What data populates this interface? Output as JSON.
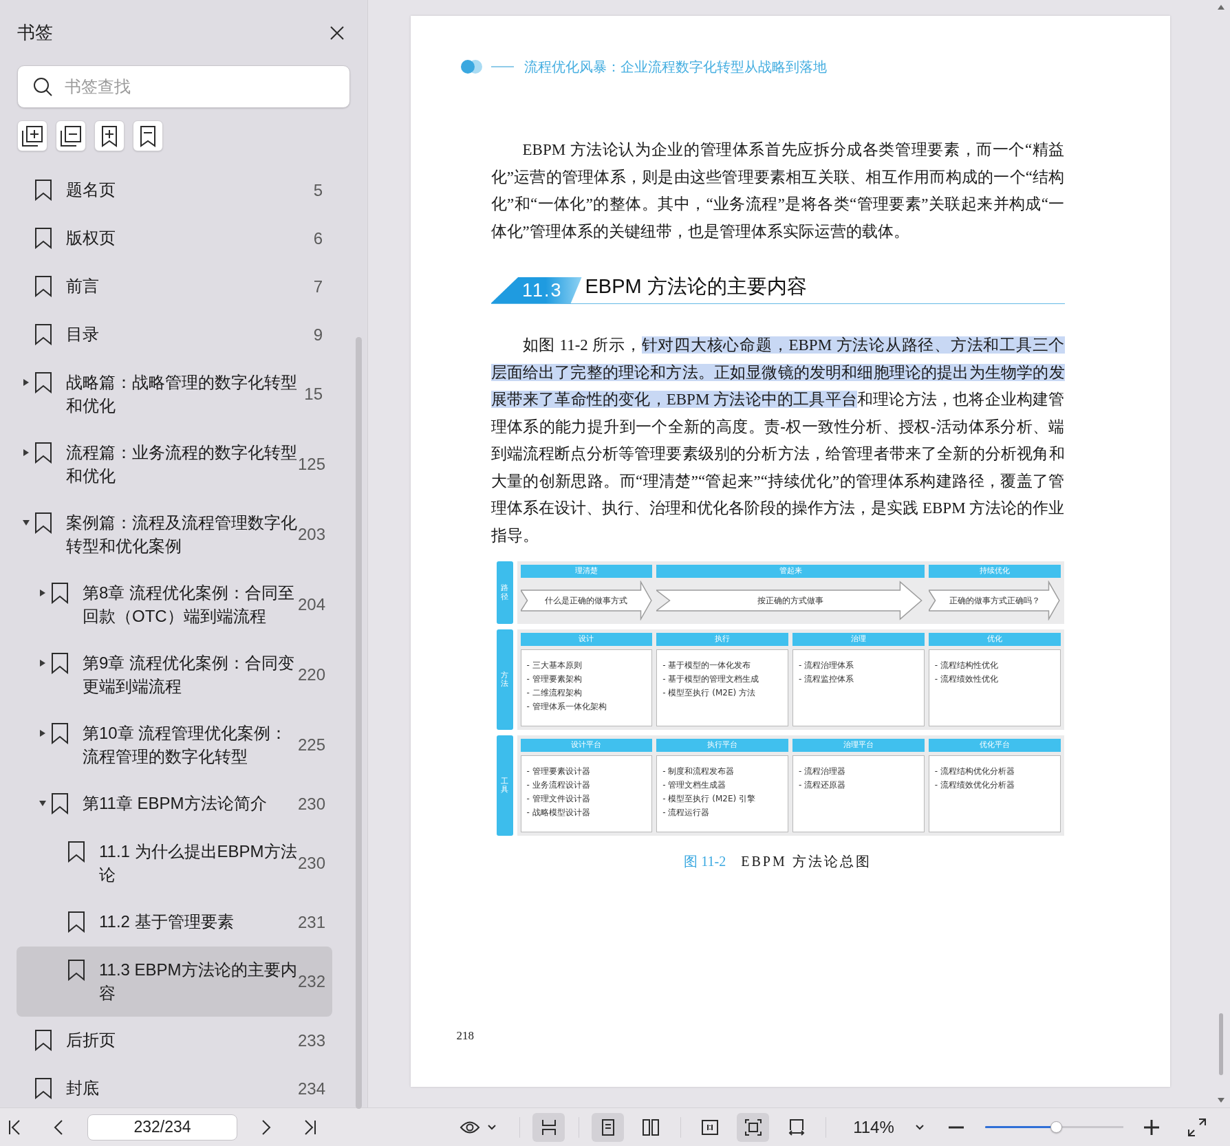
{
  "sidebar": {
    "title": "书签",
    "search": {
      "placeholder": "书签查找"
    },
    "tools": [
      {
        "kind": "expand-all"
      },
      {
        "kind": "collapse-all"
      },
      {
        "kind": "add"
      },
      {
        "kind": "remove"
      }
    ],
    "bookmarks": [
      {
        "label": "题名页",
        "page": "5",
        "selected": false
      },
      {
        "label": "版权页",
        "page": "6",
        "selected": false
      },
      {
        "label": "前言",
        "page": "7",
        "selected": false
      },
      {
        "label": "目录",
        "page": "9",
        "selected": false
      },
      {
        "label": "战略篇：战略管理的数字化转型和优化",
        "page": "15",
        "selected": false,
        "expanded": false
      },
      {
        "label": "流程篇：业务流程的数字化转型和优化",
        "page": "125",
        "selected": false,
        "expanded": false
      },
      {
        "label": "案例篇：流程及流程管理数字化转型和优化案例",
        "page": "203",
        "selected": false,
        "expanded": true,
        "children": [
          {
            "label": "第8章 流程优化案例：合同至回款（OTC）端到端流程",
            "page": "204",
            "selected": false,
            "expanded": false
          },
          {
            "label": "第9章 流程优化案例：合同变更端到端流程",
            "page": "220",
            "selected": false,
            "expanded": false
          },
          {
            "label": "第10章 流程管理优化案例：流程管理的数字化转型",
            "page": "225",
            "selected": false,
            "expanded": false
          },
          {
            "label": "第11章 EBPM方法论简介",
            "page": "230",
            "selected": false,
            "expanded": true,
            "children": [
              {
                "label": "11.1 为什么提出EBPM方法论",
                "page": "230",
                "selected": false
              },
              {
                "label": "11.2 基于管理要素",
                "page": "231",
                "selected": false
              },
              {
                "label": "11.3 EBPM方法论的主要内容",
                "page": "232",
                "selected": true
              }
            ]
          }
        ]
      },
      {
        "label": "后折页",
        "page": "233",
        "selected": false
      },
      {
        "label": "封底",
        "page": "234",
        "selected": false
      }
    ]
  },
  "page": {
    "running_header": "流程优化风暴：企业流程数字化转型从战略到落地",
    "paragraph_1": "EBPM 方法论认为企业的管理体系首先应拆分成各类管理要素，而一个“精益化”运营的管理体系，则是由这些管理要素相互关联、相互作用而构成的一个“结构化”和“一体化”的整体。其中，“业务流程”是将各类“管理要素”关联起来并构成“一体化”管理体系的关键纽带，也是管理体系实际运营的载体。",
    "section_number": "11.3",
    "section_title": "EBPM 方法论的主要内容",
    "paragraph_2": [
      {
        "text": "如图 11-2 所示，",
        "highlighted": false
      },
      {
        "text": "针对四大核心命题，EBPM 方法论从路径、方法和工具三个层面给出了完整的理论和方法。正如显微镜的发明和细胞理论的提出为生物学的发展带来了革命性的变化，EBPM 方法论中的工具平台",
        "highlighted": true
      },
      {
        "text": "和理论方法，也将企业构建管理体系的能力提升到一个全新的高度。责-权一致性分析、授权-活动体系分析、端到端流程断点分析等管理要素级别的分析方法，给管理者带来了全新的分析视角和大量的创新思路。而“理清楚”“管起来”“持续优化”的管理体系构建路径，覆盖了管理体系在设计、执行、治理和优化各阶段的操作方法，是实践 EBPM 方法论的作业指导。",
        "highlighted": false
      }
    ],
    "figure": {
      "rows": [
        {
          "label": "路径",
          "kind": "path",
          "stages": [
            {
              "header": "理清楚",
              "arrow": "什么是正确的做事方式",
              "kind": "single"
            },
            {
              "header": "管起来",
              "arrow": "按正确的方式做事",
              "kind": "wide"
            },
            {
              "header": "持续优化",
              "arrow": "正确的做事方式正确吗？",
              "kind": "single"
            }
          ]
        },
        {
          "label": "方法",
          "kind": "boxes",
          "columns": [
            {
              "header": "设计",
              "items": [
                "- 三大基本原则",
                "- 管理要素架构",
                "- 二维流程架构",
                "- 管理体系一体化架构"
              ]
            },
            {
              "header": "执行",
              "items": [
                "- 基于模型的一体化发布",
                "- 基于模型的管理文档生成",
                "- 模型至执行 (M2E) 方法"
              ]
            },
            {
              "header": "治理",
              "items": [
                "- 流程治理体系",
                "- 流程监控体系"
              ]
            },
            {
              "header": "优化",
              "items": [
                "- 流程结构性优化",
                "- 流程绩效性优化"
              ]
            }
          ]
        },
        {
          "label": "工具",
          "kind": "boxes",
          "columns": [
            {
              "header": "设计平台",
              "items": [
                "- 管理要素设计器",
                "- 业务流程设计器",
                "- 管理文件设计器",
                "- 战略模型设计器"
              ]
            },
            {
              "header": "执行平台",
              "items": [
                "-  制度和流程发布器",
                "-  管理文档生成器",
                "-  模型至执行 (M2E) 引擎",
                "-  流程运行器"
              ]
            },
            {
              "header": "治理平台",
              "items": [
                "- 流程治理器",
                "- 流程还原器"
              ]
            },
            {
              "header": "优化平台",
              "items": [
                "- 流程结构优化分析器",
                "- 流程绩效优化分析器"
              ]
            }
          ]
        }
      ],
      "caption_number": "图 11-2",
      "caption_text": "EBPM 方法论总图"
    },
    "page_number": "218"
  },
  "toolbar": {
    "page_field": "232/234",
    "view_buttons": [
      {
        "kind": "scroll",
        "selected": true
      },
      {
        "kind": "single",
        "selected": true
      },
      {
        "kind": "double",
        "selected": false
      },
      {
        "kind": "actual",
        "selected": false
      },
      {
        "kind": "fit",
        "selected": true
      },
      {
        "kind": "fit-width",
        "selected": false
      }
    ],
    "zoom": {
      "value": "114%",
      "level": 0.51
    }
  }
}
